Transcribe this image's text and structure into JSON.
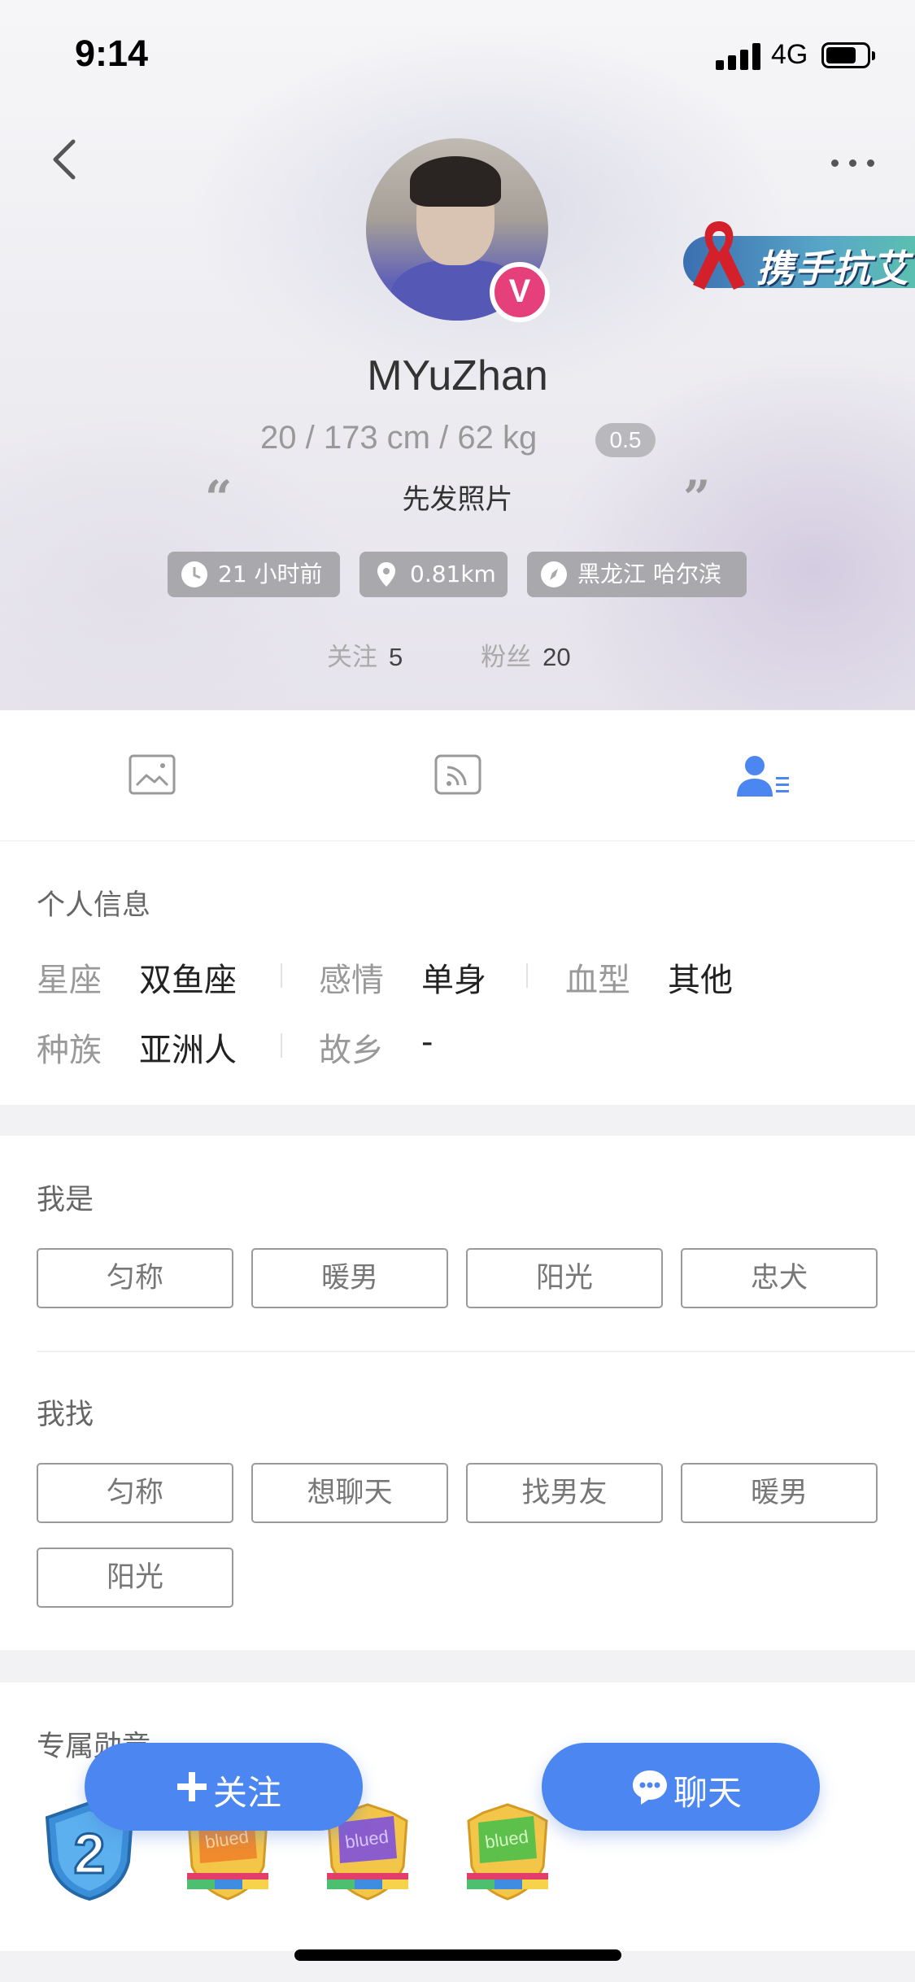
{
  "status_bar": {
    "time": "9:14",
    "network": "4G",
    "battery_level": 0.75
  },
  "profile": {
    "username": "MYuZhan",
    "stats": "20 / 173 cm / 62 kg",
    "level": "0.5",
    "verified_badge": "V",
    "bio": "先发照片",
    "banner_text": "携手抗艾",
    "chips": {
      "last_active": "21 小时前",
      "distance": "0.81km",
      "location": "黑龙江 哈尔滨"
    },
    "following_label": "关注",
    "following_count": "5",
    "followers_label": "粉丝",
    "followers_count": "20"
  },
  "tabs": [
    {
      "icon": "photo-icon"
    },
    {
      "icon": "feed-icon"
    },
    {
      "icon": "profile-info-icon",
      "active": true
    }
  ],
  "personal_info": {
    "title": "个人信息",
    "rows": [
      [
        {
          "label": "星座",
          "value": "双鱼座"
        },
        {
          "label": "感情",
          "value": "单身"
        },
        {
          "label": "血型",
          "value": "其他"
        }
      ],
      [
        {
          "label": "种族",
          "value": "亚洲人"
        },
        {
          "label": "故乡",
          "value": "-"
        }
      ]
    ]
  },
  "i_am": {
    "title": "我是",
    "tags": [
      "匀称",
      "暖男",
      "阳光",
      "忠犬"
    ]
  },
  "looking_for": {
    "title": "我找",
    "tags": [
      "匀称",
      "想聊天",
      "找男友",
      "暖男",
      "阳光"
    ]
  },
  "medals": {
    "title": "专属勋章",
    "items": [
      "level-2-shield",
      "blued-flag-orange",
      "blued-flag-purple",
      "blued-flag-green"
    ],
    "level_number": "2"
  },
  "actions": {
    "follow_label": "关注",
    "chat_label": "聊天"
  },
  "colors": {
    "accent": "#4c86f0",
    "verified": "#e6407a",
    "chip_bg": "#a9a9ad"
  }
}
